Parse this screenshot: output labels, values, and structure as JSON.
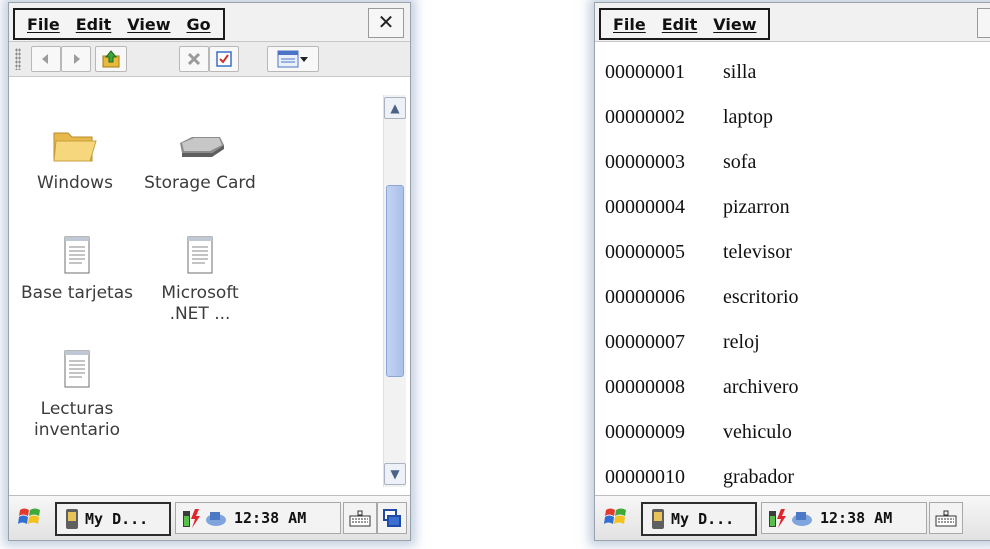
{
  "left": {
    "menu": [
      "File",
      "Edit",
      "View",
      "Go"
    ],
    "close_glyph": "✕",
    "items": [
      {
        "label": "Windows",
        "icon": "folder-icon"
      },
      {
        "label": "Storage Card",
        "icon": "storage-card-icon"
      },
      {
        "label": "Base tarjetas",
        "icon": "notepad-file-icon"
      },
      {
        "label": "Microsoft .NET ...",
        "icon": "notepad-file-icon"
      },
      {
        "label": "Lecturas inventario",
        "icon": "notepad-file-icon"
      }
    ],
    "taskbar": {
      "task_label": "My D...",
      "time": "12:38 AM"
    }
  },
  "right": {
    "menu": [
      "File",
      "Edit",
      "View"
    ],
    "rows": [
      {
        "code": "00000001",
        "name": "silla"
      },
      {
        "code": "00000002",
        "name": "laptop"
      },
      {
        "code": "00000003",
        "name": "sofa"
      },
      {
        "code": "00000004",
        "name": "pizarron"
      },
      {
        "code": "00000005",
        "name": "televisor"
      },
      {
        "code": "00000006",
        "name": "escritorio"
      },
      {
        "code": "00000007",
        "name": "reloj"
      },
      {
        "code": "00000008",
        "name": "archivero"
      },
      {
        "code": "00000009",
        "name": "vehiculo"
      },
      {
        "code": "00000010",
        "name": "grabador"
      }
    ],
    "taskbar": {
      "task_label": "My D...",
      "time": "12:38 AM"
    }
  },
  "colors": {
    "scroll_thumb": "#aac0ea",
    "folder": "#f3cf6b",
    "accent_blue": "#4a6286"
  }
}
